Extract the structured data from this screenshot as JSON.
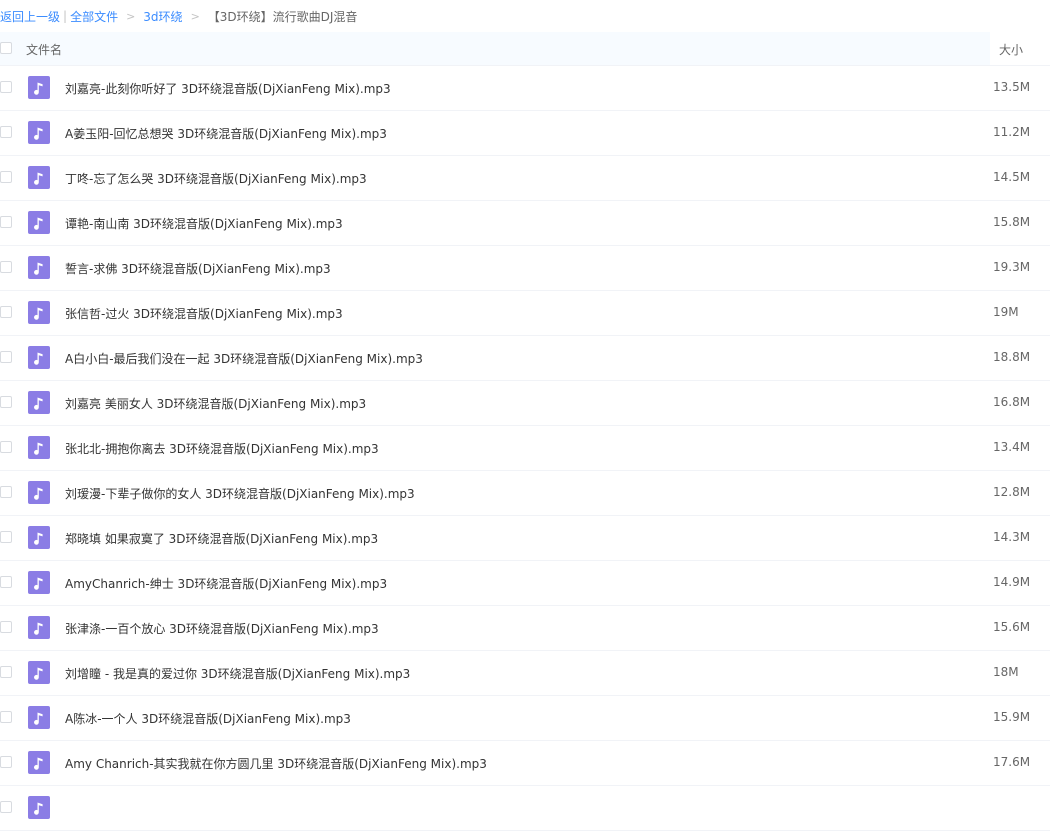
{
  "breadcrumb": {
    "back": "返回上一级",
    "all_files": "全部文件",
    "folder": "3d环绕",
    "current": "【3D环绕】流行歌曲DJ混音"
  },
  "columns": {
    "name": "文件名",
    "size": "大小"
  },
  "file_icon": "music-note-icon",
  "files": [
    {
      "name": "刘嘉亮-此刻你听好了 3D环绕混音版(DjXianFeng Mix).mp3",
      "size": "13.5M"
    },
    {
      "name": "A姜玉阳-回忆总想哭 3D环绕混音版(DjXianFeng Mix).mp3",
      "size": "11.2M"
    },
    {
      "name": "丁咚-忘了怎么哭 3D环绕混音版(DjXianFeng Mix).mp3",
      "size": "14.5M"
    },
    {
      "name": "谭艳-南山南 3D环绕混音版(DjXianFeng Mix).mp3",
      "size": "15.8M"
    },
    {
      "name": "誓言-求佛 3D环绕混音版(DjXianFeng Mix).mp3",
      "size": "19.3M"
    },
    {
      "name": "张信哲-过火 3D环绕混音版(DjXianFeng Mix).mp3",
      "size": "19M"
    },
    {
      "name": "A白小白-最后我们没在一起 3D环绕混音版(DjXianFeng Mix).mp3",
      "size": "18.8M"
    },
    {
      "name": "刘嘉亮 美丽女人 3D环绕混音版(DjXianFeng Mix).mp3",
      "size": "16.8M"
    },
    {
      "name": "张北北-拥抱你离去 3D环绕混音版(DjXianFeng Mix).mp3",
      "size": "13.4M"
    },
    {
      "name": "刘瑷漫-下辈子做你的女人 3D环绕混音版(DjXianFeng Mix).mp3",
      "size": "12.8M"
    },
    {
      "name": "郑晓填 如果寂寞了 3D环绕混音版(DjXianFeng Mix).mp3",
      "size": "14.3M"
    },
    {
      "name": "AmyChanrich-绅士 3D环绕混音版(DjXianFeng Mix).mp3",
      "size": "14.9M"
    },
    {
      "name": "张津涤-一百个放心 3D环绕混音版(DjXianFeng Mix).mp3",
      "size": "15.6M"
    },
    {
      "name": "刘增瞳 - 我是真的爱过你 3D环绕混音版(DjXianFeng Mix).mp3",
      "size": "18M"
    },
    {
      "name": "A陈冰-一个人 3D环绕混音版(DjXianFeng Mix).mp3",
      "size": "15.9M"
    },
    {
      "name": "Amy Chanrich-其实我就在你方圆几里 3D环绕混音版(DjXianFeng Mix).mp3",
      "size": "17.6M"
    },
    {
      "name": "",
      "size": ""
    }
  ]
}
